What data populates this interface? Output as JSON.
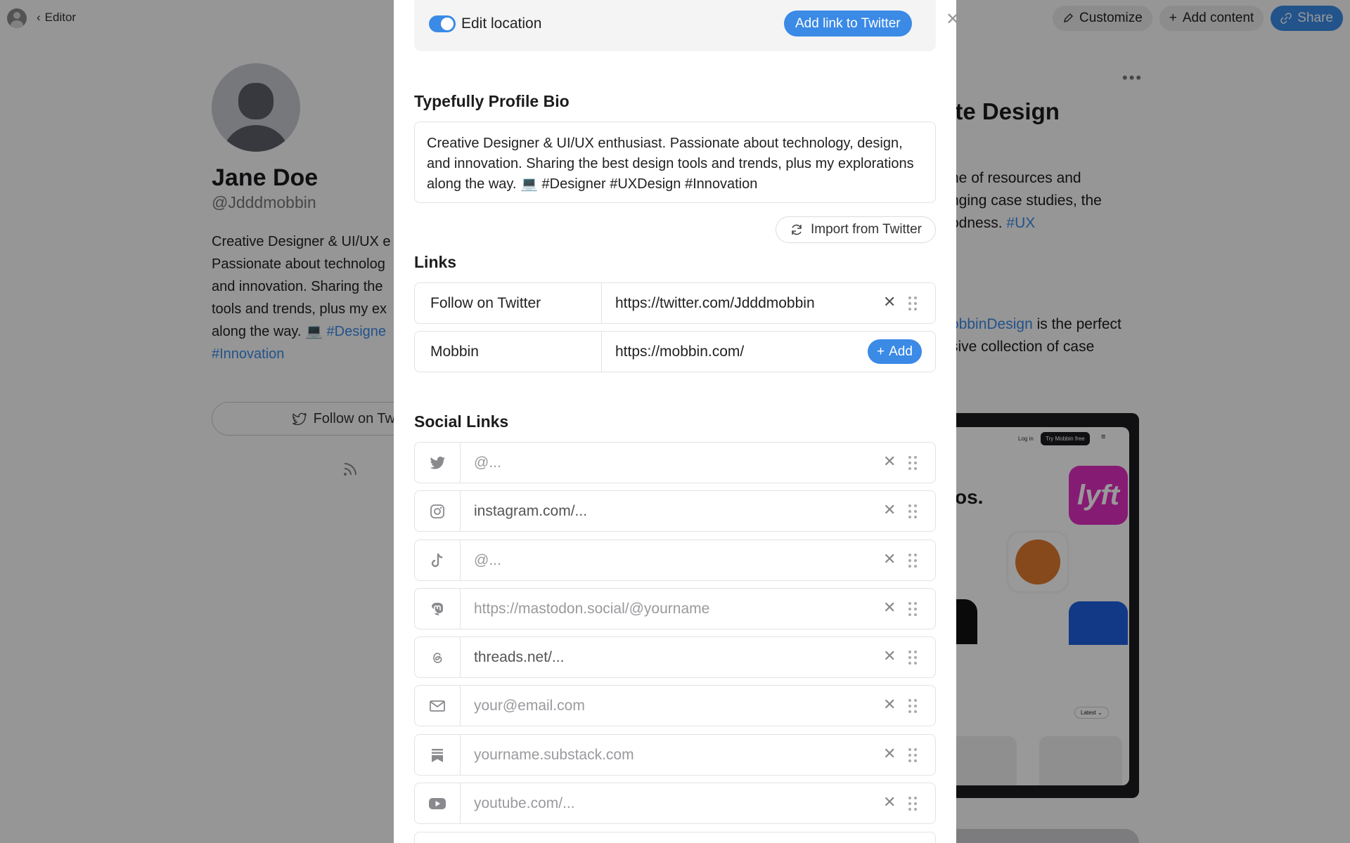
{
  "topbar": {
    "back_label": "Editor",
    "customize_label": "Customize",
    "add_content_label": "Add content",
    "share_label": "Share"
  },
  "profile": {
    "name": "Jane Doe",
    "handle": "@Jdddmobbin",
    "bio_line1": "Creative Designer & UI/UX e",
    "bio_line2": "Passionate about technolog",
    "bio_line3": "and innovation. Sharing the",
    "bio_line4": "tools and trends, plus my ex",
    "bio_line5_a": "along the way. 💻 ",
    "bio_line5_b": "#Designe",
    "bio_line6": "#Innovation",
    "follow_label": "Follow on Twi"
  },
  "right": {
    "title": "ate Design",
    "text1_line1": "ne of resources and",
    "text1_line2": "nging case studies, the",
    "text1_line3_a": "odness. ",
    "text1_line3_b": "#UX",
    "text2_line1_a": "obbinDesign",
    "text2_line1_b": " is the perfect",
    "text2_line2": "sive collection of case",
    "preview": {
      "login": "Log in",
      "try": "Try Mobbin free",
      "ps": "os.",
      "lyft": "lyft",
      "latest": "Latest ⌄"
    }
  },
  "modal": {
    "location_label": "Edit location",
    "add_twitter_label": "Add link to Twitter",
    "bio_title": "Typefully Profile Bio",
    "bio_text": "Creative Designer & UI/UX enthusiast. Passionate about technology, design, and innovation. Sharing the best design tools and trends, plus my explorations along the way. 💻 #Designer #UXDesign #Innovation",
    "import_label": "Import from Twitter",
    "links_title": "Links",
    "links": [
      {
        "name": "Follow on Twitter",
        "url": "https://twitter.com/Jdddmobbin"
      },
      {
        "name": "Mobbin",
        "url": "https://mobbin.com/",
        "add_label": "Add"
      }
    ],
    "social_title": "Social Links",
    "social": [
      {
        "icon": "twitter-icon",
        "value": "@..."
      },
      {
        "icon": "instagram-icon",
        "value": "instagram.com/..."
      },
      {
        "icon": "tiktok-icon",
        "value": "@..."
      },
      {
        "icon": "mastodon-icon",
        "value": "https://mastodon.social/@yourname"
      },
      {
        "icon": "threads-icon",
        "value": "threads.net/..."
      },
      {
        "icon": "email-icon",
        "value": "your@email.com"
      },
      {
        "icon": "substack-icon",
        "value": "yourname.substack.com"
      },
      {
        "icon": "youtube-icon",
        "value": "youtube.com/..."
      }
    ]
  },
  "colors": {
    "accent": "#3a8ae6",
    "overlay": "rgba(0,0,0,0.4)"
  }
}
